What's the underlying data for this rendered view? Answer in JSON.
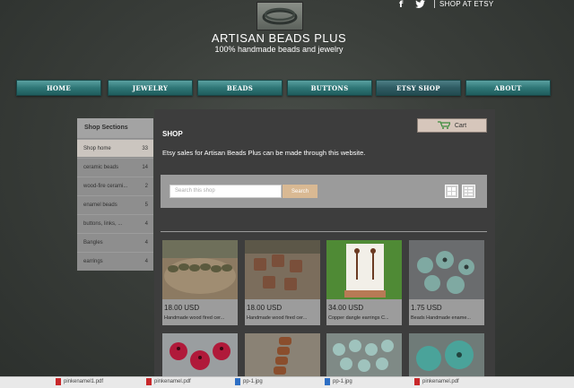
{
  "header": {
    "site_title": "ARTISAN BEADS PLUS",
    "tagline": "100% handmade beads and jewelry",
    "social": {
      "facebook": "f",
      "twitter": "🐦"
    },
    "etsy_link": "SHOP AT ETSY"
  },
  "nav": [
    "HOME",
    "JEWELRY",
    "BEADS",
    "BUTTONS",
    "ETSY SHOP",
    "ABOUT"
  ],
  "sidebar": {
    "heading": "Shop Sections",
    "items": [
      {
        "label": "Shop home",
        "count": "33"
      },
      {
        "label": "ceramic beads",
        "count": "14"
      },
      {
        "label": "wood-fire cerami...",
        "count": "2"
      },
      {
        "label": "enamel beads",
        "count": "5"
      },
      {
        "label": "buttons, links, ...",
        "count": "4"
      },
      {
        "label": "Bangles",
        "count": "4"
      },
      {
        "label": "earrings",
        "count": "4"
      }
    ]
  },
  "main": {
    "cart_label": "Cart",
    "heading": "SHOP",
    "intro": "Etsy sales for Artisan Beads Plus can be made through this website.",
    "search_placeholder": "Search this shop",
    "search_button": "Search"
  },
  "products": [
    {
      "price": "18.00 USD",
      "title": "Handmade wood fired cer..."
    },
    {
      "price": "18.00 USD",
      "title": "Handmade wood fired cer..."
    },
    {
      "price": "34.00 USD",
      "title": "Copper dangle earrings C..."
    },
    {
      "price": "1.75 USD",
      "title": "Beads Handmade ename..."
    }
  ],
  "downloads": [
    "pinkenamel1.pdf",
    "pinkenamel.pdf",
    "pp-1.jpg",
    "pp-1.jpg",
    "pinkenamel.pdf"
  ],
  "colors": {
    "nav_teal": "#2f7777",
    "search_button": "#d9b993",
    "panel": "#3d3d3d"
  }
}
